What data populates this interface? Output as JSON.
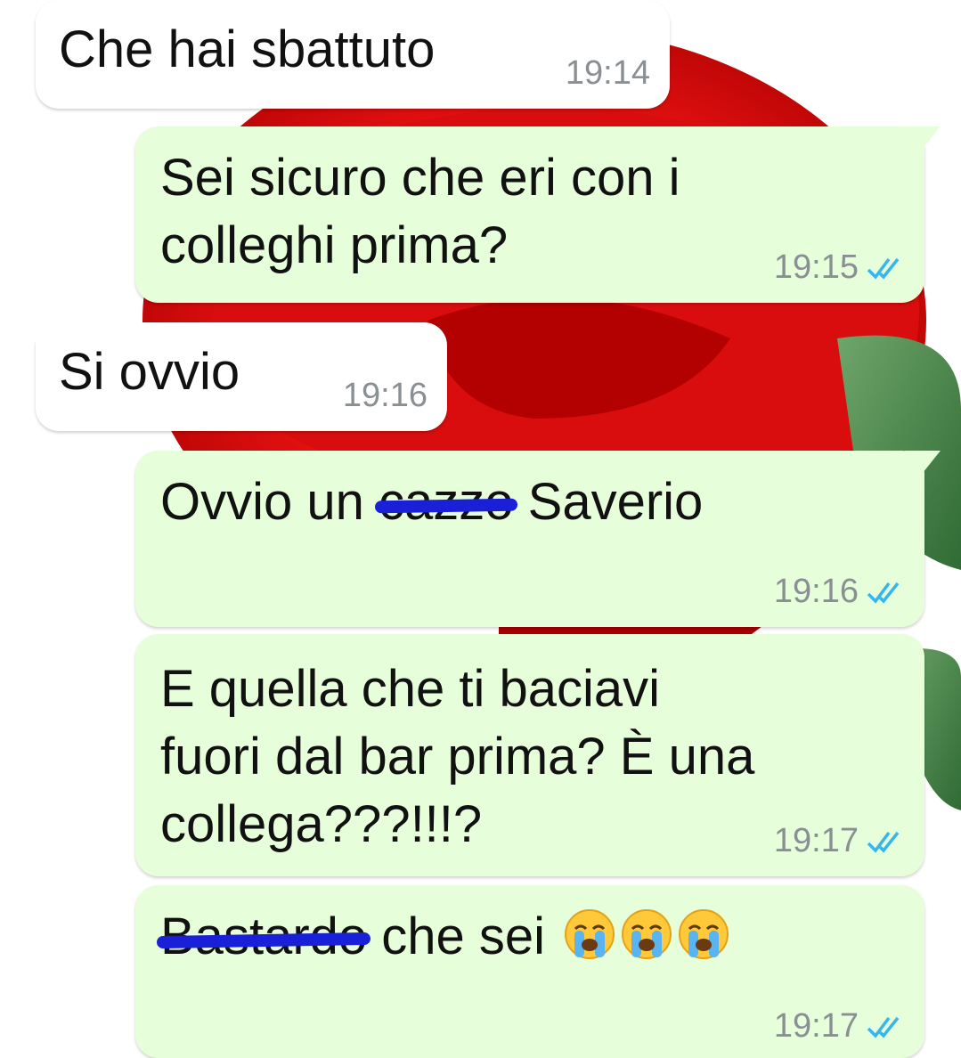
{
  "messages": [
    {
      "direction": "incoming",
      "text": "Che hai sbattuto",
      "time": "19:14"
    },
    {
      "direction": "outgoing",
      "lines": [
        "Sei sicuro che eri con i",
        "colleghi prima?"
      ],
      "time": "19:15",
      "status": "read-double-check"
    },
    {
      "direction": "incoming",
      "text": "Si ovvio",
      "time": "19:16"
    },
    {
      "direction": "outgoing",
      "parts": [
        "Ovvio un ",
        "cazzo",
        " Saverio"
      ],
      "struck": "cazzo",
      "time": "19:16",
      "status": "read-double-check"
    },
    {
      "direction": "outgoing",
      "lines": [
        "E quella che ti baciavi",
        "fuori dal bar prima? È una",
        "collega???!!!?"
      ],
      "time": "19:17",
      "status": "read-double-check"
    },
    {
      "direction": "outgoing",
      "parts": [
        "Bastardo",
        " che sei "
      ],
      "struck": "Bastardo",
      "emoji": [
        "loudly-crying-face",
        "loudly-crying-face",
        "loudly-crying-face"
      ],
      "time": "19:17",
      "status": "read-double-check"
    }
  ],
  "colors": {
    "incoming": "#ffffff",
    "outgoing": "#e6ffda",
    "read_ticks": "#34b7f1",
    "scribble": "#1a1fd8"
  }
}
